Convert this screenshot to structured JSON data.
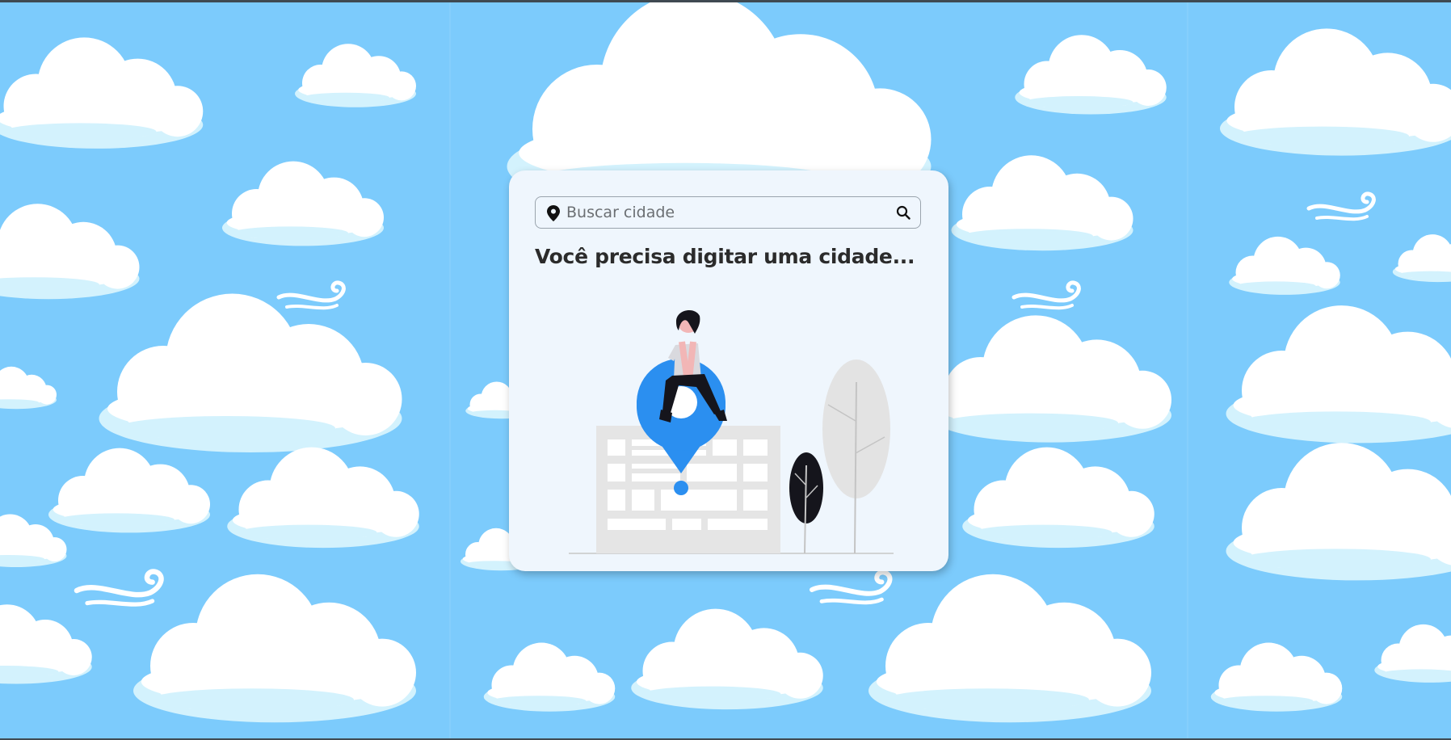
{
  "search": {
    "placeholder": "Buscar cidade",
    "value": "",
    "left_icon": "map-pin-icon",
    "right_icon": "search-icon"
  },
  "message": "Você precisa digitar uma cidade...",
  "illustration": "woman-sitting-on-location-pin-illustration",
  "colors": {
    "sky": "#7ccbfc",
    "card_background": "#eff6fd",
    "pin_blue": "#2b8ff0",
    "text": "#2b2b2b"
  }
}
